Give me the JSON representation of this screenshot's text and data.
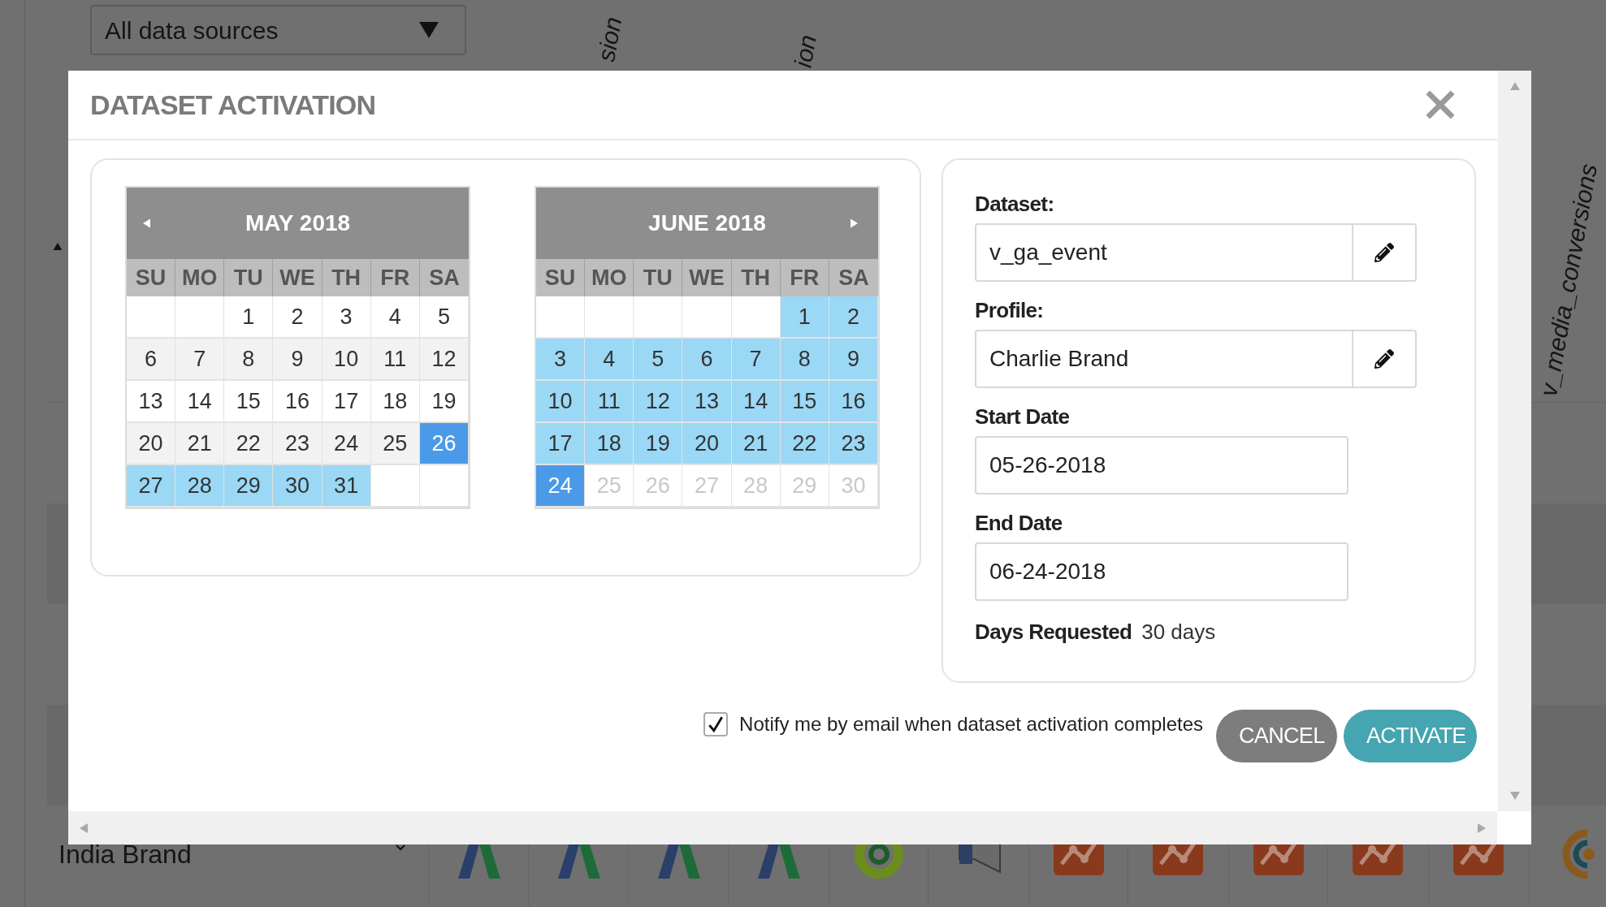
{
  "background": {
    "source_filter": {
      "value": "All data sources"
    },
    "column_headers": [
      "sion",
      "ion",
      "v_media_conversions"
    ],
    "row_labels": [
      "India Brand"
    ],
    "row_icons": [
      {
        "kind": "ads"
      },
      {
        "kind": "ads"
      },
      {
        "kind": "ads"
      },
      {
        "kind": "ads"
      },
      {
        "kind": "ring"
      },
      {
        "kind": "megaphone"
      },
      {
        "kind": "chart"
      },
      {
        "kind": "chart"
      },
      {
        "kind": "chart"
      },
      {
        "kind": "chart"
      },
      {
        "kind": "chart"
      },
      {
        "kind": "target"
      }
    ]
  },
  "dialog": {
    "title": "DATASET ACTIVATION",
    "calendars": [
      {
        "month": "MAY 2018",
        "prev_button": true,
        "next_button": false,
        "weekdays": [
          "SU",
          "MO",
          "TU",
          "WE",
          "TH",
          "FR",
          "SA"
        ],
        "weeks": [
          [
            {
              "kind": "blank"
            },
            {
              "kind": "blank"
            },
            {
              "kind": "day",
              "day": "1",
              "selected": false,
              "in_range": false,
              "disabled": false
            },
            {
              "kind": "day",
              "day": "2",
              "selected": false,
              "in_range": false,
              "disabled": false
            },
            {
              "kind": "day",
              "day": "3",
              "selected": false,
              "in_range": false,
              "disabled": false
            },
            {
              "kind": "day",
              "day": "4",
              "selected": false,
              "in_range": false,
              "disabled": false
            },
            {
              "kind": "day",
              "day": "5",
              "selected": false,
              "in_range": false,
              "disabled": false
            }
          ],
          [
            {
              "kind": "day",
              "day": "6",
              "selected": false,
              "in_range": false,
              "disabled": false
            },
            {
              "kind": "day",
              "day": "7",
              "selected": false,
              "in_range": false,
              "disabled": false
            },
            {
              "kind": "day",
              "day": "8",
              "selected": false,
              "in_range": false,
              "disabled": false
            },
            {
              "kind": "day",
              "day": "9",
              "selected": false,
              "in_range": false,
              "disabled": false
            },
            {
              "kind": "day",
              "day": "10",
              "selected": false,
              "in_range": false,
              "disabled": false
            },
            {
              "kind": "day",
              "day": "11",
              "selected": false,
              "in_range": false,
              "disabled": false
            },
            {
              "kind": "day",
              "day": "12",
              "selected": false,
              "in_range": false,
              "disabled": false
            }
          ],
          [
            {
              "kind": "day",
              "day": "13",
              "selected": false,
              "in_range": false,
              "disabled": false
            },
            {
              "kind": "day",
              "day": "14",
              "selected": false,
              "in_range": false,
              "disabled": false
            },
            {
              "kind": "day",
              "day": "15",
              "selected": false,
              "in_range": false,
              "disabled": false
            },
            {
              "kind": "day",
              "day": "16",
              "selected": false,
              "in_range": false,
              "disabled": false
            },
            {
              "kind": "day",
              "day": "17",
              "selected": false,
              "in_range": false,
              "disabled": false
            },
            {
              "kind": "day",
              "day": "18",
              "selected": false,
              "in_range": false,
              "disabled": false
            },
            {
              "kind": "day",
              "day": "19",
              "selected": false,
              "in_range": false,
              "disabled": false
            }
          ],
          [
            {
              "kind": "day",
              "day": "20",
              "selected": false,
              "in_range": false,
              "disabled": false
            },
            {
              "kind": "day",
              "day": "21",
              "selected": false,
              "in_range": false,
              "disabled": false
            },
            {
              "kind": "day",
              "day": "22",
              "selected": false,
              "in_range": false,
              "disabled": false
            },
            {
              "kind": "day",
              "day": "23",
              "selected": false,
              "in_range": false,
              "disabled": false
            },
            {
              "kind": "day",
              "day": "24",
              "selected": false,
              "in_range": false,
              "disabled": false
            },
            {
              "kind": "day",
              "day": "25",
              "selected": false,
              "in_range": false,
              "disabled": false
            },
            {
              "kind": "day",
              "day": "26",
              "selected": true,
              "in_range": false,
              "disabled": false
            }
          ],
          [
            {
              "kind": "day",
              "day": "27",
              "selected": false,
              "in_range": true,
              "disabled": false
            },
            {
              "kind": "day",
              "day": "28",
              "selected": false,
              "in_range": true,
              "disabled": false
            },
            {
              "kind": "day",
              "day": "29",
              "selected": false,
              "in_range": true,
              "disabled": false
            },
            {
              "kind": "day",
              "day": "30",
              "selected": false,
              "in_range": true,
              "disabled": false
            },
            {
              "kind": "day",
              "day": "31",
              "selected": false,
              "in_range": true,
              "disabled": false
            },
            {
              "kind": "blank"
            },
            {
              "kind": "blank"
            }
          ]
        ]
      },
      {
        "month": "JUNE 2018",
        "prev_button": false,
        "next_button": true,
        "weekdays": [
          "SU",
          "MO",
          "TU",
          "WE",
          "TH",
          "FR",
          "SA"
        ],
        "weeks": [
          [
            {
              "kind": "blank"
            },
            {
              "kind": "blank"
            },
            {
              "kind": "blank"
            },
            {
              "kind": "blank"
            },
            {
              "kind": "blank"
            },
            {
              "kind": "day",
              "day": "1",
              "selected": false,
              "in_range": true,
              "disabled": false
            },
            {
              "kind": "day",
              "day": "2",
              "selected": false,
              "in_range": true,
              "disabled": false
            }
          ],
          [
            {
              "kind": "day",
              "day": "3",
              "selected": false,
              "in_range": true,
              "disabled": false
            },
            {
              "kind": "day",
              "day": "4",
              "selected": false,
              "in_range": true,
              "disabled": false
            },
            {
              "kind": "day",
              "day": "5",
              "selected": false,
              "in_range": true,
              "disabled": false
            },
            {
              "kind": "day",
              "day": "6",
              "selected": false,
              "in_range": true,
              "disabled": false
            },
            {
              "kind": "day",
              "day": "7",
              "selected": false,
              "in_range": true,
              "disabled": false
            },
            {
              "kind": "day",
              "day": "8",
              "selected": false,
              "in_range": true,
              "disabled": false
            },
            {
              "kind": "day",
              "day": "9",
              "selected": false,
              "in_range": true,
              "disabled": false
            }
          ],
          [
            {
              "kind": "day",
              "day": "10",
              "selected": false,
              "in_range": true,
              "disabled": false
            },
            {
              "kind": "day",
              "day": "11",
              "selected": false,
              "in_range": true,
              "disabled": false
            },
            {
              "kind": "day",
              "day": "12",
              "selected": false,
              "in_range": true,
              "disabled": false
            },
            {
              "kind": "day",
              "day": "13",
              "selected": false,
              "in_range": true,
              "disabled": false
            },
            {
              "kind": "day",
              "day": "14",
              "selected": false,
              "in_range": true,
              "disabled": false
            },
            {
              "kind": "day",
              "day": "15",
              "selected": false,
              "in_range": true,
              "disabled": false
            },
            {
              "kind": "day",
              "day": "16",
              "selected": false,
              "in_range": true,
              "disabled": false
            }
          ],
          [
            {
              "kind": "day",
              "day": "17",
              "selected": false,
              "in_range": true,
              "disabled": false
            },
            {
              "kind": "day",
              "day": "18",
              "selected": false,
              "in_range": true,
              "disabled": false
            },
            {
              "kind": "day",
              "day": "19",
              "selected": false,
              "in_range": true,
              "disabled": false
            },
            {
              "kind": "day",
              "day": "20",
              "selected": false,
              "in_range": true,
              "disabled": false
            },
            {
              "kind": "day",
              "day": "21",
              "selected": false,
              "in_range": true,
              "disabled": false
            },
            {
              "kind": "day",
              "day": "22",
              "selected": false,
              "in_range": true,
              "disabled": false
            },
            {
              "kind": "day",
              "day": "23",
              "selected": false,
              "in_range": true,
              "disabled": false
            }
          ],
          [
            {
              "kind": "day",
              "day": "24",
              "selected": true,
              "in_range": false,
              "disabled": false
            },
            {
              "kind": "day",
              "day": "25",
              "selected": false,
              "in_range": false,
              "disabled": true
            },
            {
              "kind": "day",
              "day": "26",
              "selected": false,
              "in_range": false,
              "disabled": true
            },
            {
              "kind": "day",
              "day": "27",
              "selected": false,
              "in_range": false,
              "disabled": true
            },
            {
              "kind": "day",
              "day": "28",
              "selected": false,
              "in_range": false,
              "disabled": true
            },
            {
              "kind": "day",
              "day": "29",
              "selected": false,
              "in_range": false,
              "disabled": true
            },
            {
              "kind": "day",
              "day": "30",
              "selected": false,
              "in_range": false,
              "disabled": true
            }
          ]
        ]
      }
    ],
    "form": {
      "fields": [
        {
          "label": "Dataset:",
          "value": "v_ga_event",
          "kind": "editable"
        },
        {
          "label": "Profile:",
          "value": "Charlie Brand",
          "kind": "editable"
        },
        {
          "label": "Start Date",
          "value": "05-26-2018",
          "kind": "date"
        },
        {
          "label": "End Date",
          "value": "06-24-2018",
          "kind": "date"
        }
      ],
      "days_requested": {
        "label": "Days Requested",
        "value": "30 days"
      }
    },
    "notify": {
      "label": "Notify me by email when dataset activation completes",
      "checked": true
    },
    "buttons": [
      {
        "label": "CANCEL",
        "kind": "secondary"
      },
      {
        "label": "ACTIVATE",
        "kind": "primary"
      }
    ]
  }
}
